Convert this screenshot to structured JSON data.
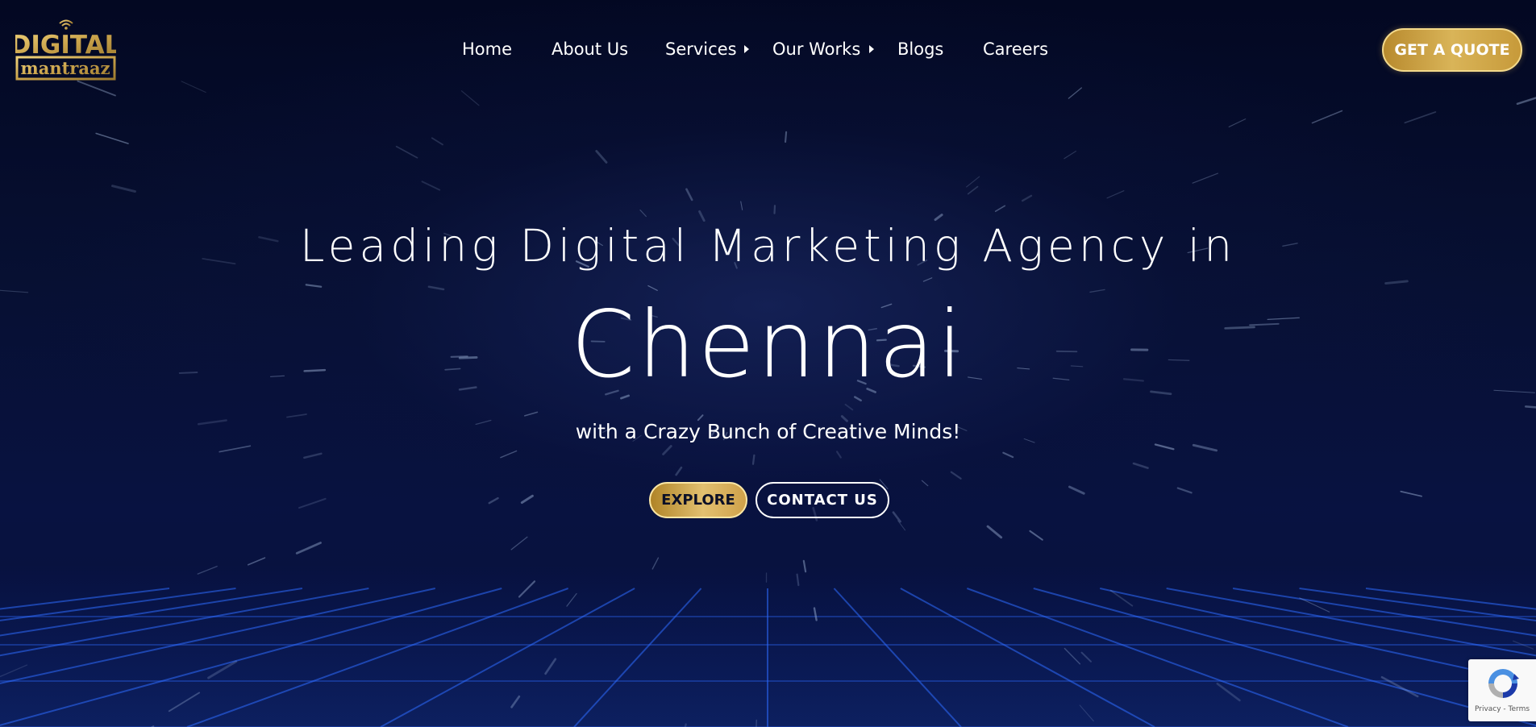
{
  "brand": {
    "logo_top": "DIGITAL",
    "logo_bottom": "mantraaz",
    "gold": "#c9a24a",
    "background": "#050b2a"
  },
  "nav": {
    "items": [
      {
        "label": "Home",
        "has_submenu": false
      },
      {
        "label": "About Us",
        "has_submenu": false
      },
      {
        "label": "Services",
        "has_submenu": true
      },
      {
        "label": "Our Works",
        "has_submenu": true
      },
      {
        "label": "Blogs",
        "has_submenu": false
      },
      {
        "label": "Careers",
        "has_submenu": false
      }
    ],
    "submenu_icon": "caret-right-icon",
    "cta_label": "GET A QUOTE"
  },
  "hero": {
    "headline": "Leading Digital Marketing Agency in",
    "city": "Chennai",
    "subtitle": "with a Crazy Bunch of Creative Minds!",
    "explore_label": "EXPLORE",
    "contact_label": "CONTACT US"
  },
  "recaptcha": {
    "icon": "recaptcha-icon",
    "terms": "Privacy - Terms"
  }
}
